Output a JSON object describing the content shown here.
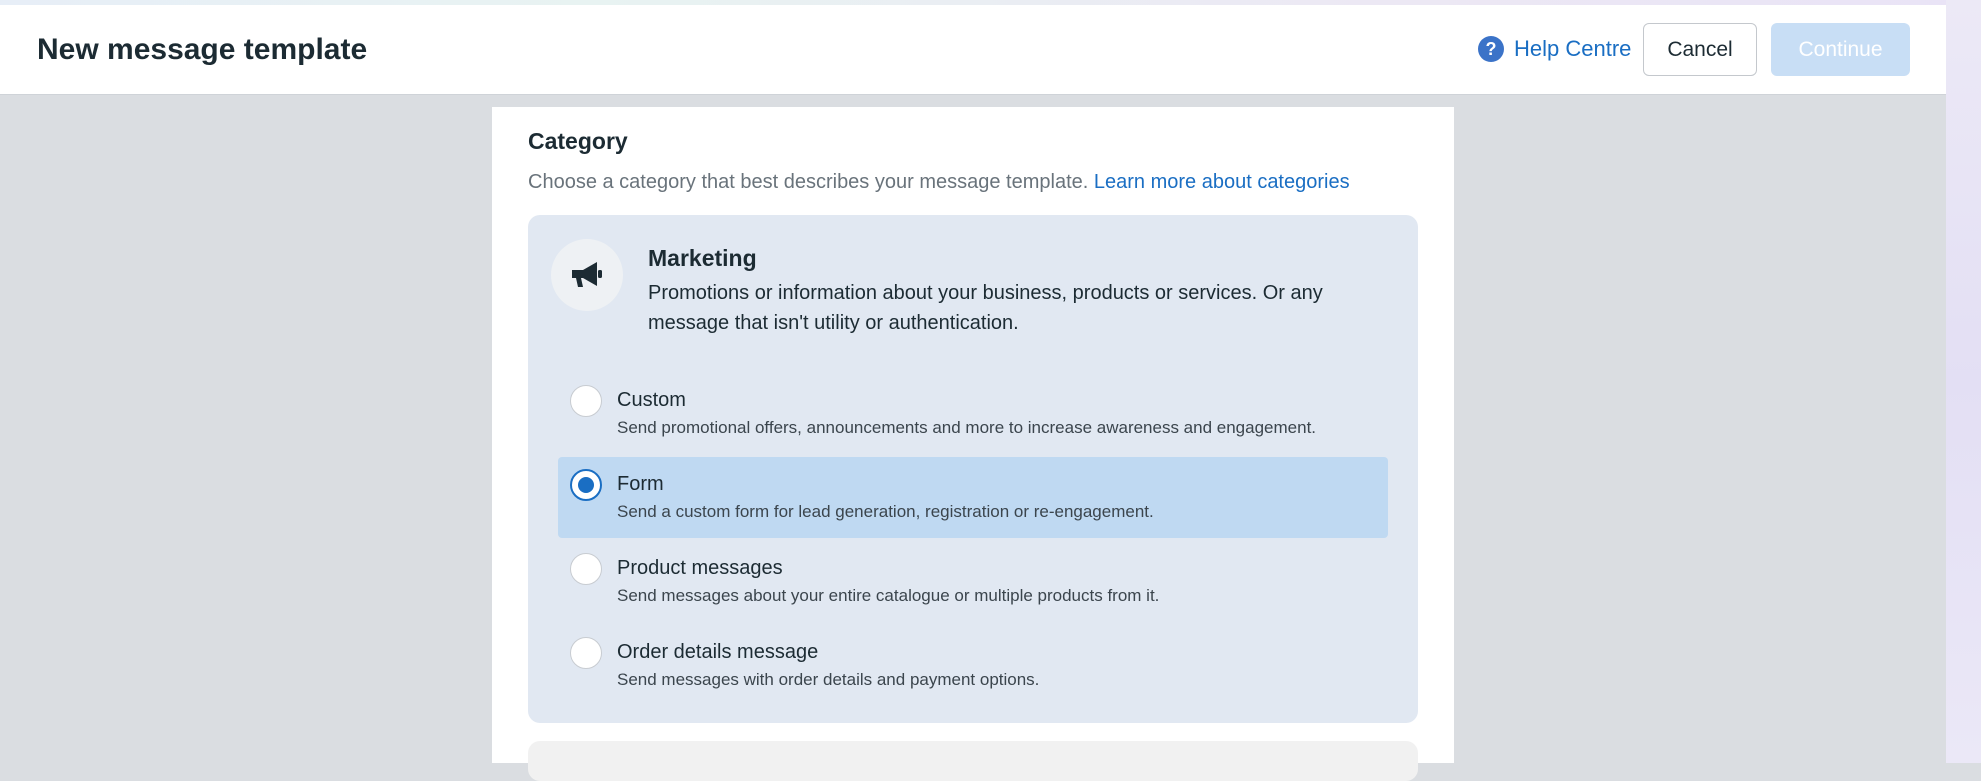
{
  "header": {
    "title": "New message template",
    "help_label": "Help Centre",
    "help_icon": "?",
    "cancel_label": "Cancel",
    "continue_label": "Continue"
  },
  "category": {
    "title": "Category",
    "description": "Choose a category that best describes your message template.",
    "learn_more": "Learn more about categories"
  },
  "marketing": {
    "icon": "megaphone-icon",
    "title": "Marketing",
    "description": "Promotions or information about your business, products or services. Or any message that isn't utility or authentication.",
    "options": [
      {
        "label": "Custom",
        "description": "Send promotional offers, announcements and more to increase awareness and engagement.",
        "selected": false
      },
      {
        "label": "Form",
        "description": "Send a custom form for lead generation, registration or re-engagement.",
        "selected": true
      },
      {
        "label": "Product messages",
        "description": "Send messages about your entire catalogue or multiple products from it.",
        "selected": false
      },
      {
        "label": "Order details message",
        "description": "Send messages with order details and payment options.",
        "selected": false
      }
    ]
  },
  "colors": {
    "accent": "#1a6ec3",
    "selected_bg": "#bfd9f2",
    "card_bg": "#e1e8f2",
    "continue_disabled": "#c8def5"
  }
}
